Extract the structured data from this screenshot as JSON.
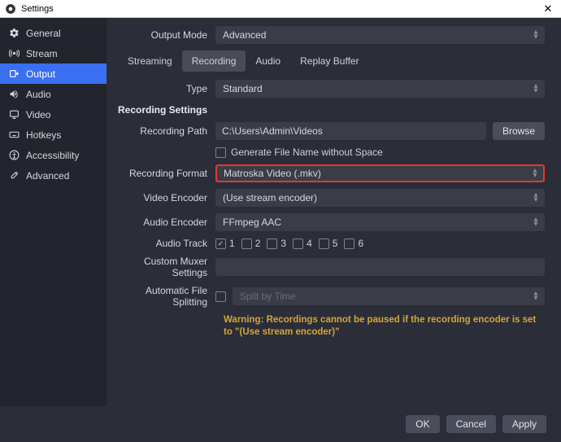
{
  "window": {
    "title": "Settings"
  },
  "sidebar": {
    "items": [
      {
        "label": "General"
      },
      {
        "label": "Stream"
      },
      {
        "label": "Output"
      },
      {
        "label": "Audio"
      },
      {
        "label": "Video"
      },
      {
        "label": "Hotkeys"
      },
      {
        "label": "Accessibility"
      },
      {
        "label": "Advanced"
      }
    ]
  },
  "output_mode": {
    "label": "Output Mode",
    "value": "Advanced"
  },
  "tabs": {
    "items": [
      {
        "label": "Streaming"
      },
      {
        "label": "Recording"
      },
      {
        "label": "Audio"
      },
      {
        "label": "Replay Buffer"
      }
    ]
  },
  "type": {
    "label": "Type",
    "value": "Standard"
  },
  "section": {
    "title": "Recording Settings"
  },
  "path": {
    "label": "Recording Path",
    "value": "C:\\Users\\Admin\\Videos",
    "browse": "Browse"
  },
  "gen_name": {
    "label": "Generate File Name without Space"
  },
  "format": {
    "label": "Recording Format",
    "value": "Matroska Video (.mkv)"
  },
  "venc": {
    "label": "Video Encoder",
    "value": "(Use stream encoder)"
  },
  "aenc": {
    "label": "Audio Encoder",
    "value": "FFmpeg AAC"
  },
  "tracks": {
    "label": "Audio Track",
    "t1": "1",
    "t2": "2",
    "t3": "3",
    "t4": "4",
    "t5": "5",
    "t6": "6"
  },
  "muxer": {
    "label": "Custom Muxer Settings",
    "value": ""
  },
  "split": {
    "label": "Automatic File Splitting",
    "value": "Split by Time"
  },
  "warning": "Warning: Recordings cannot be paused if the recording encoder is set to \"(Use stream encoder)\"",
  "buttons": {
    "ok": "OK",
    "cancel": "Cancel",
    "apply": "Apply"
  }
}
